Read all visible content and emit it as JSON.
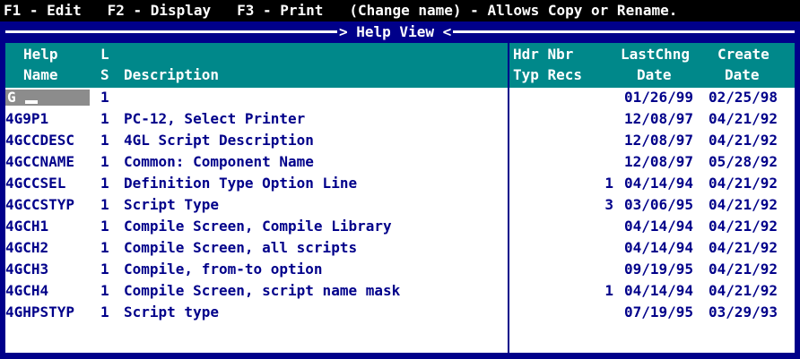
{
  "top_bar": {
    "text": "F1 - Edit   F2 - Display   F3 - Print   (Change name) - Allows Copy or Rename."
  },
  "window": {
    "title": "> Help View <"
  },
  "columns": {
    "help_name": [
      "Help",
      "Name"
    ],
    "ls": [
      "L",
      "S"
    ],
    "description": "Description",
    "hdr_nbr": [
      "Hdr Nbr",
      "Typ Recs"
    ],
    "last_chng": [
      "LastChng",
      "Date"
    ],
    "create": [
      "Create",
      "Date"
    ]
  },
  "name_field": {
    "value": "G"
  },
  "rows": [
    {
      "name": "",
      "ls": "1",
      "desc": "",
      "recs": "",
      "last": "01/26/99",
      "create": "02/25/98"
    },
    {
      "name": "4G9P1",
      "ls": "1",
      "desc": "PC-12, Select Printer",
      "recs": "",
      "last": "12/08/97",
      "create": "04/21/92"
    },
    {
      "name": "4GCCDESC",
      "ls": "1",
      "desc": "4GL Script Description",
      "recs": "",
      "last": "12/08/97",
      "create": "04/21/92"
    },
    {
      "name": "4GCCNAME",
      "ls": "1",
      "desc": "Common: Component Name",
      "recs": "",
      "last": "12/08/97",
      "create": "05/28/92"
    },
    {
      "name": "4GCCSEL",
      "ls": "1",
      "desc": "Definition Type Option Line",
      "recs": "1",
      "last": "04/14/94",
      "create": "04/21/92"
    },
    {
      "name": "4GCCSTYP",
      "ls": "1",
      "desc": "Script Type",
      "recs": "3",
      "last": "03/06/95",
      "create": "04/21/92"
    },
    {
      "name": "4GCH1",
      "ls": "1",
      "desc": "Compile Screen, Compile Library",
      "recs": "",
      "last": "04/14/94",
      "create": "04/21/92"
    },
    {
      "name": "4GCH2",
      "ls": "1",
      "desc": "Compile Screen, all scripts",
      "recs": "",
      "last": "04/14/94",
      "create": "04/21/92"
    },
    {
      "name": "4GCH3",
      "ls": "1",
      "desc": "Compile, from-to option",
      "recs": "",
      "last": "09/19/95",
      "create": "04/21/92"
    },
    {
      "name": "4GCH4",
      "ls": "1",
      "desc": "Compile Screen, script name mask",
      "recs": "1",
      "last": "04/14/94",
      "create": "04/21/92"
    },
    {
      "name": "4GHPSTYP",
      "ls": "1",
      "desc": "Script type",
      "recs": "",
      "last": "07/19/95",
      "create": "03/29/93"
    }
  ],
  "colors": {
    "frame": "#00008a",
    "header": "#00888a",
    "text": "#00008a",
    "field": "#8c8c8c"
  }
}
